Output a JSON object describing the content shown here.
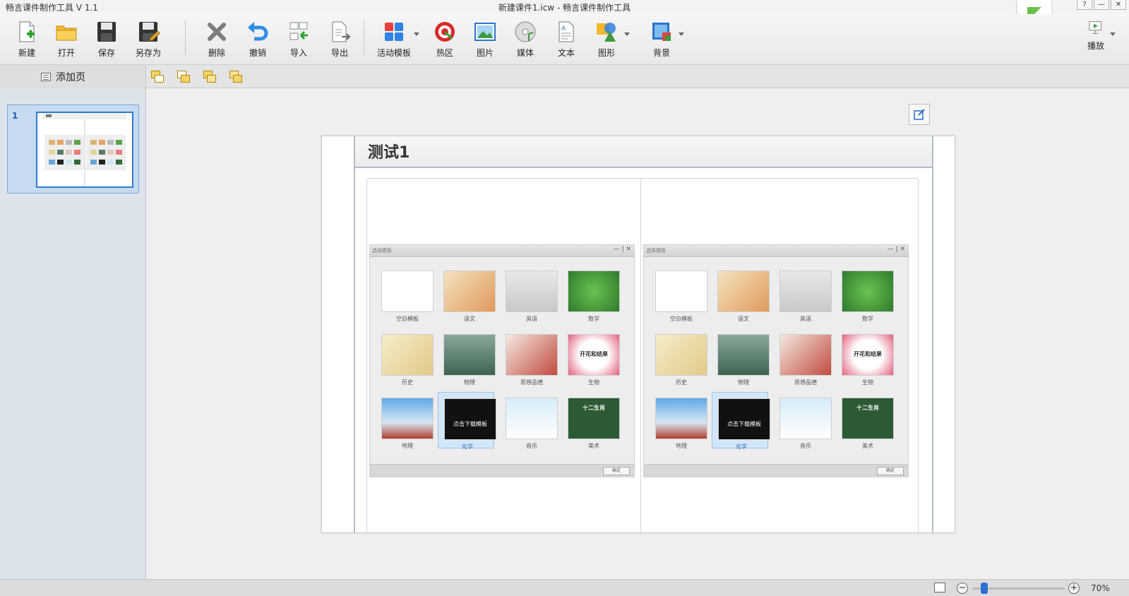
{
  "window": {
    "app_title": "畅言课件制作工具 V 1.1",
    "doc_title": "新建课件1.icw - 畅言课件制作工具",
    "controls": [
      "?",
      "—",
      "✕"
    ]
  },
  "toolbar": {
    "new": "新建",
    "open": "打开",
    "save": "保存",
    "save_as": "另存为",
    "delete": "删除",
    "undo": "撤销",
    "import": "导入",
    "export": "导出",
    "activity_template": "活动模板",
    "hotspot": "热区",
    "picture": "图片",
    "media": "媒体",
    "text": "文本",
    "shape": "图形",
    "background": "背景",
    "play": "播放"
  },
  "subbar": {
    "add_page": "添加页"
  },
  "sidebar": {
    "pages": [
      {
        "number": "1"
      }
    ]
  },
  "slide": {
    "title": "测试1",
    "template_tiles": [
      {
        "caption": "空白模板"
      },
      {
        "caption": "语文"
      },
      {
        "caption": "英语"
      },
      {
        "caption": "数学"
      },
      {
        "caption": "历史"
      },
      {
        "caption": "物理"
      },
      {
        "caption": "思想品德"
      },
      {
        "caption": "生物"
      },
      {
        "caption": "地理"
      },
      {
        "caption": "化学",
        "selected": true,
        "overlay": "点击下载模板"
      },
      {
        "caption": "音乐"
      },
      {
        "caption": "美术",
        "overlay": "十二生肖"
      }
    ],
    "banner_text": "开花和结果"
  },
  "status": {
    "zoom": "70%",
    "zoom_fraction": 0.13
  },
  "colors": {
    "accent": "#2b6fd1",
    "sidebar_bg": "#dde3ea",
    "selection": "#2f7bd0"
  }
}
